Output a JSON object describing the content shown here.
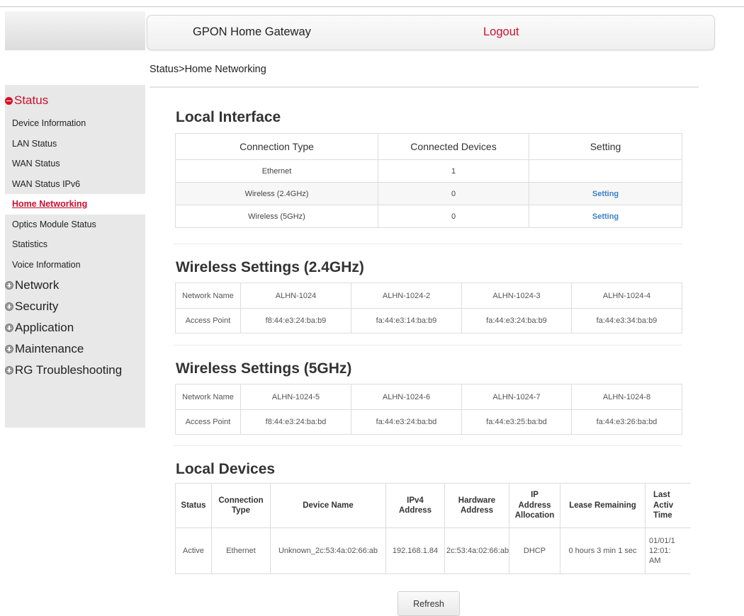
{
  "header": {
    "brand": "GPON Home Gateway",
    "logout": "Logout"
  },
  "breadcrumb": "Status>Home Networking",
  "sidebar": {
    "status_group": "Status",
    "status_items": [
      "Device Information",
      "LAN Status",
      "WAN Status",
      "WAN Status IPv6",
      "Home Networking",
      "Optics Module Status",
      "Statistics",
      "Voice Information"
    ],
    "active_item": "Home Networking",
    "groups": [
      "Network",
      "Security",
      "Application",
      "Maintenance",
      "RG Troubleshooting"
    ]
  },
  "local_interface": {
    "title": "Local Interface",
    "headers": [
      "Connection Type",
      "Connected Devices",
      "Setting"
    ],
    "rows": [
      {
        "type": "Ethernet",
        "devices": "1",
        "setting": ""
      },
      {
        "type": "Wireless (2.4GHz)",
        "devices": "0",
        "setting": "Setting"
      },
      {
        "type": "Wireless (5GHz)",
        "devices": "0",
        "setting": "Setting"
      }
    ]
  },
  "wireless24": {
    "title": "Wireless Settings (2.4GHz)",
    "row_labels": [
      "Network Name",
      "Access Point"
    ],
    "names": [
      "ALHN-1024",
      "ALHN-1024-2",
      "ALHN-1024-3",
      "ALHN-1024-4"
    ],
    "aps": [
      "f8:44:e3:24:ba:b9",
      "fa:44:e3:14:ba:b9",
      "fa:44:e3:24:ba:b9",
      "fa:44:e3:34:ba:b9"
    ]
  },
  "wireless5": {
    "title": "Wireless Settings (5GHz)",
    "row_labels": [
      "Network Name",
      "Access Point"
    ],
    "names": [
      "ALHN-1024-5",
      "ALHN-1024-6",
      "ALHN-1024-7",
      "ALHN-1024-8"
    ],
    "aps": [
      "f8:44:e3:24:ba:bd",
      "fa:44:e3:24:ba:bd",
      "fa:44:e3:25:ba:bd",
      "fa:44:e3:26:ba:bd"
    ]
  },
  "local_devices": {
    "title": "Local Devices",
    "headers": [
      "Status",
      "Connection\nType",
      "Device Name",
      "IPv4\nAddress",
      "Hardware\nAddress",
      "IP\nAddress\nAllocation",
      "Lease Remaining",
      "Last\nActiv\nTime"
    ],
    "row": [
      "Active",
      "Ethernet",
      "Unknown_2c:53:4a:02:66:ab",
      "192.168.1.84",
      "2c:53:4a:02:66:ab",
      "DHCP",
      "0 hours 3 min 1 sec",
      "01/01/1\n12:01:\nAM"
    ]
  },
  "refresh_label": "Refresh"
}
